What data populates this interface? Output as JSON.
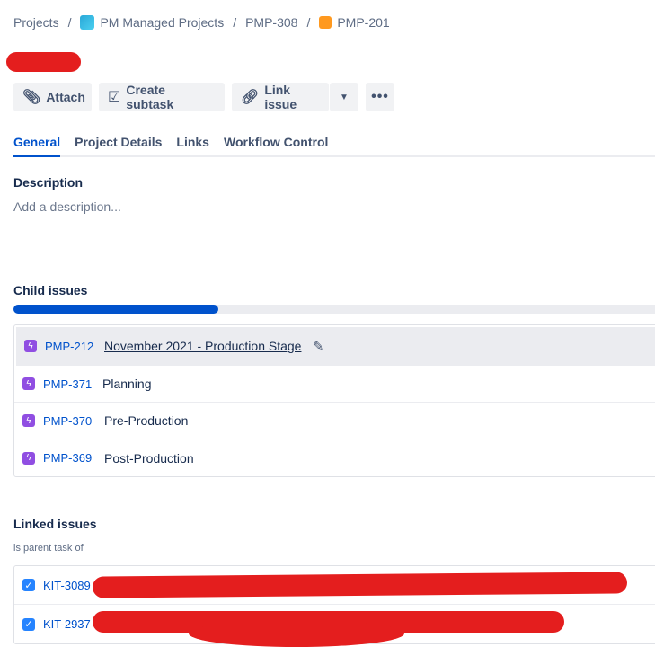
{
  "breadcrumb": [
    {
      "label": "Projects"
    },
    {
      "label": "PM Managed Projects",
      "icon": "project-icon",
      "color": "#2aa8d8"
    },
    {
      "label": "PMP-308"
    },
    {
      "label": "PMP-201",
      "icon": "idea-icon",
      "color": "#ff991f"
    }
  ],
  "toolbar": {
    "attach": "Attach",
    "create_subtask": "Create subtask",
    "link_issue": "Link issue"
  },
  "tabs": [
    "General",
    "Project Details",
    "Links",
    "Workflow Control"
  ],
  "description": {
    "heading": "Description",
    "placeholder": "Add a description..."
  },
  "child_issues": {
    "heading": "Child issues",
    "progress_percent": 32,
    "items": [
      {
        "key": "PMP-212",
        "summary": "November 2021 - Production Stage"
      },
      {
        "key": "PMP-371",
        "summary": "Planning"
      },
      {
        "key": "PMP-370",
        "summary": "Pre-Production"
      },
      {
        "key": "PMP-369",
        "summary": "Post-Production"
      }
    ]
  },
  "linked_issues": {
    "heading": "Linked issues",
    "relation": "is parent task of",
    "items": [
      {
        "key": "KIT-3089"
      },
      {
        "key": "KIT-2937"
      }
    ]
  },
  "colors": {
    "accent": "#0052cc",
    "redaction": "#e41e1e"
  }
}
